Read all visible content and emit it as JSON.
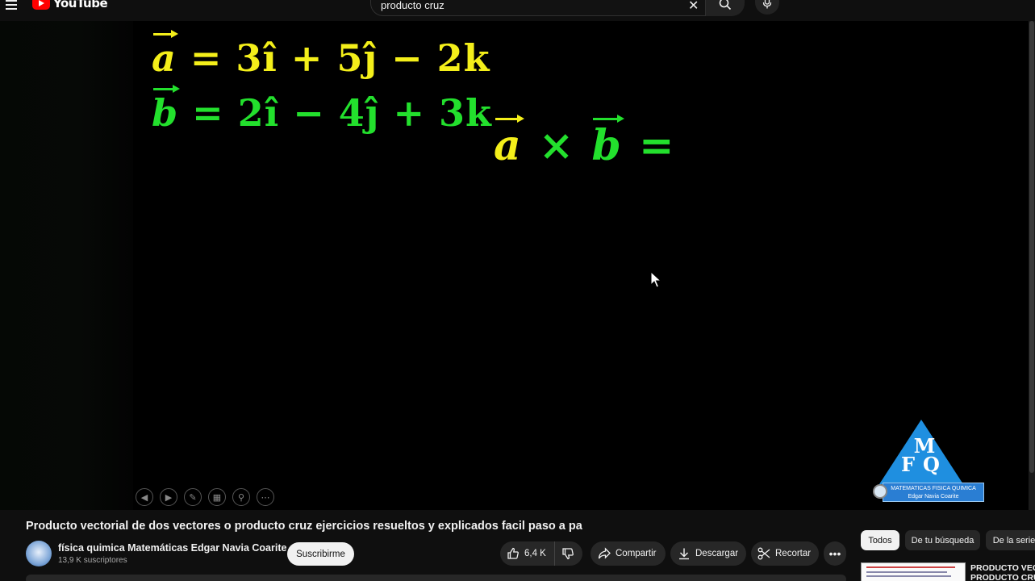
{
  "header": {
    "logo_text": "YouTube",
    "search_value": "producto cruz"
  },
  "video": {
    "equation_a": {
      "vec": "a",
      "rest": " = 3î + 5ĵ − 2k"
    },
    "equation_b": {
      "vec": "b",
      "rest": " = 2î − 4ĵ + 3k"
    },
    "cross_product": {
      "left": "a",
      "op": " × ",
      "right": "b",
      "eq": " ="
    },
    "watermark": {
      "letters_top": "M",
      "letters_bottom": "FQ",
      "line1": "MATEMATICAS FISICA QUIMICA",
      "line2": "Edgar Navia Coarite"
    },
    "colors": {
      "a": "#f4ef1a",
      "b": "#23e02d",
      "background": "#000000"
    }
  },
  "info": {
    "title": "Producto vectorial de dos vectores o producto cruz ejercicios resueltos y explicados facil paso a pa",
    "channel_name": "física quimica Matemáticas Edgar Navia Coarite",
    "subscribers": "13,9 K suscriptores",
    "subscribe_label": "Suscribirme",
    "likes": "6,4 K",
    "share_label": "Compartir",
    "download_label": "Descargar",
    "clip_label": "Recortar"
  },
  "sidebar": {
    "chips": [
      "Todos",
      "De tu búsqueda",
      "De la serie"
    ],
    "recommended_title_line1": "PRODUCTO VECTORIAL",
    "recommended_title_line2": "PRODUCTO CRUZ"
  }
}
